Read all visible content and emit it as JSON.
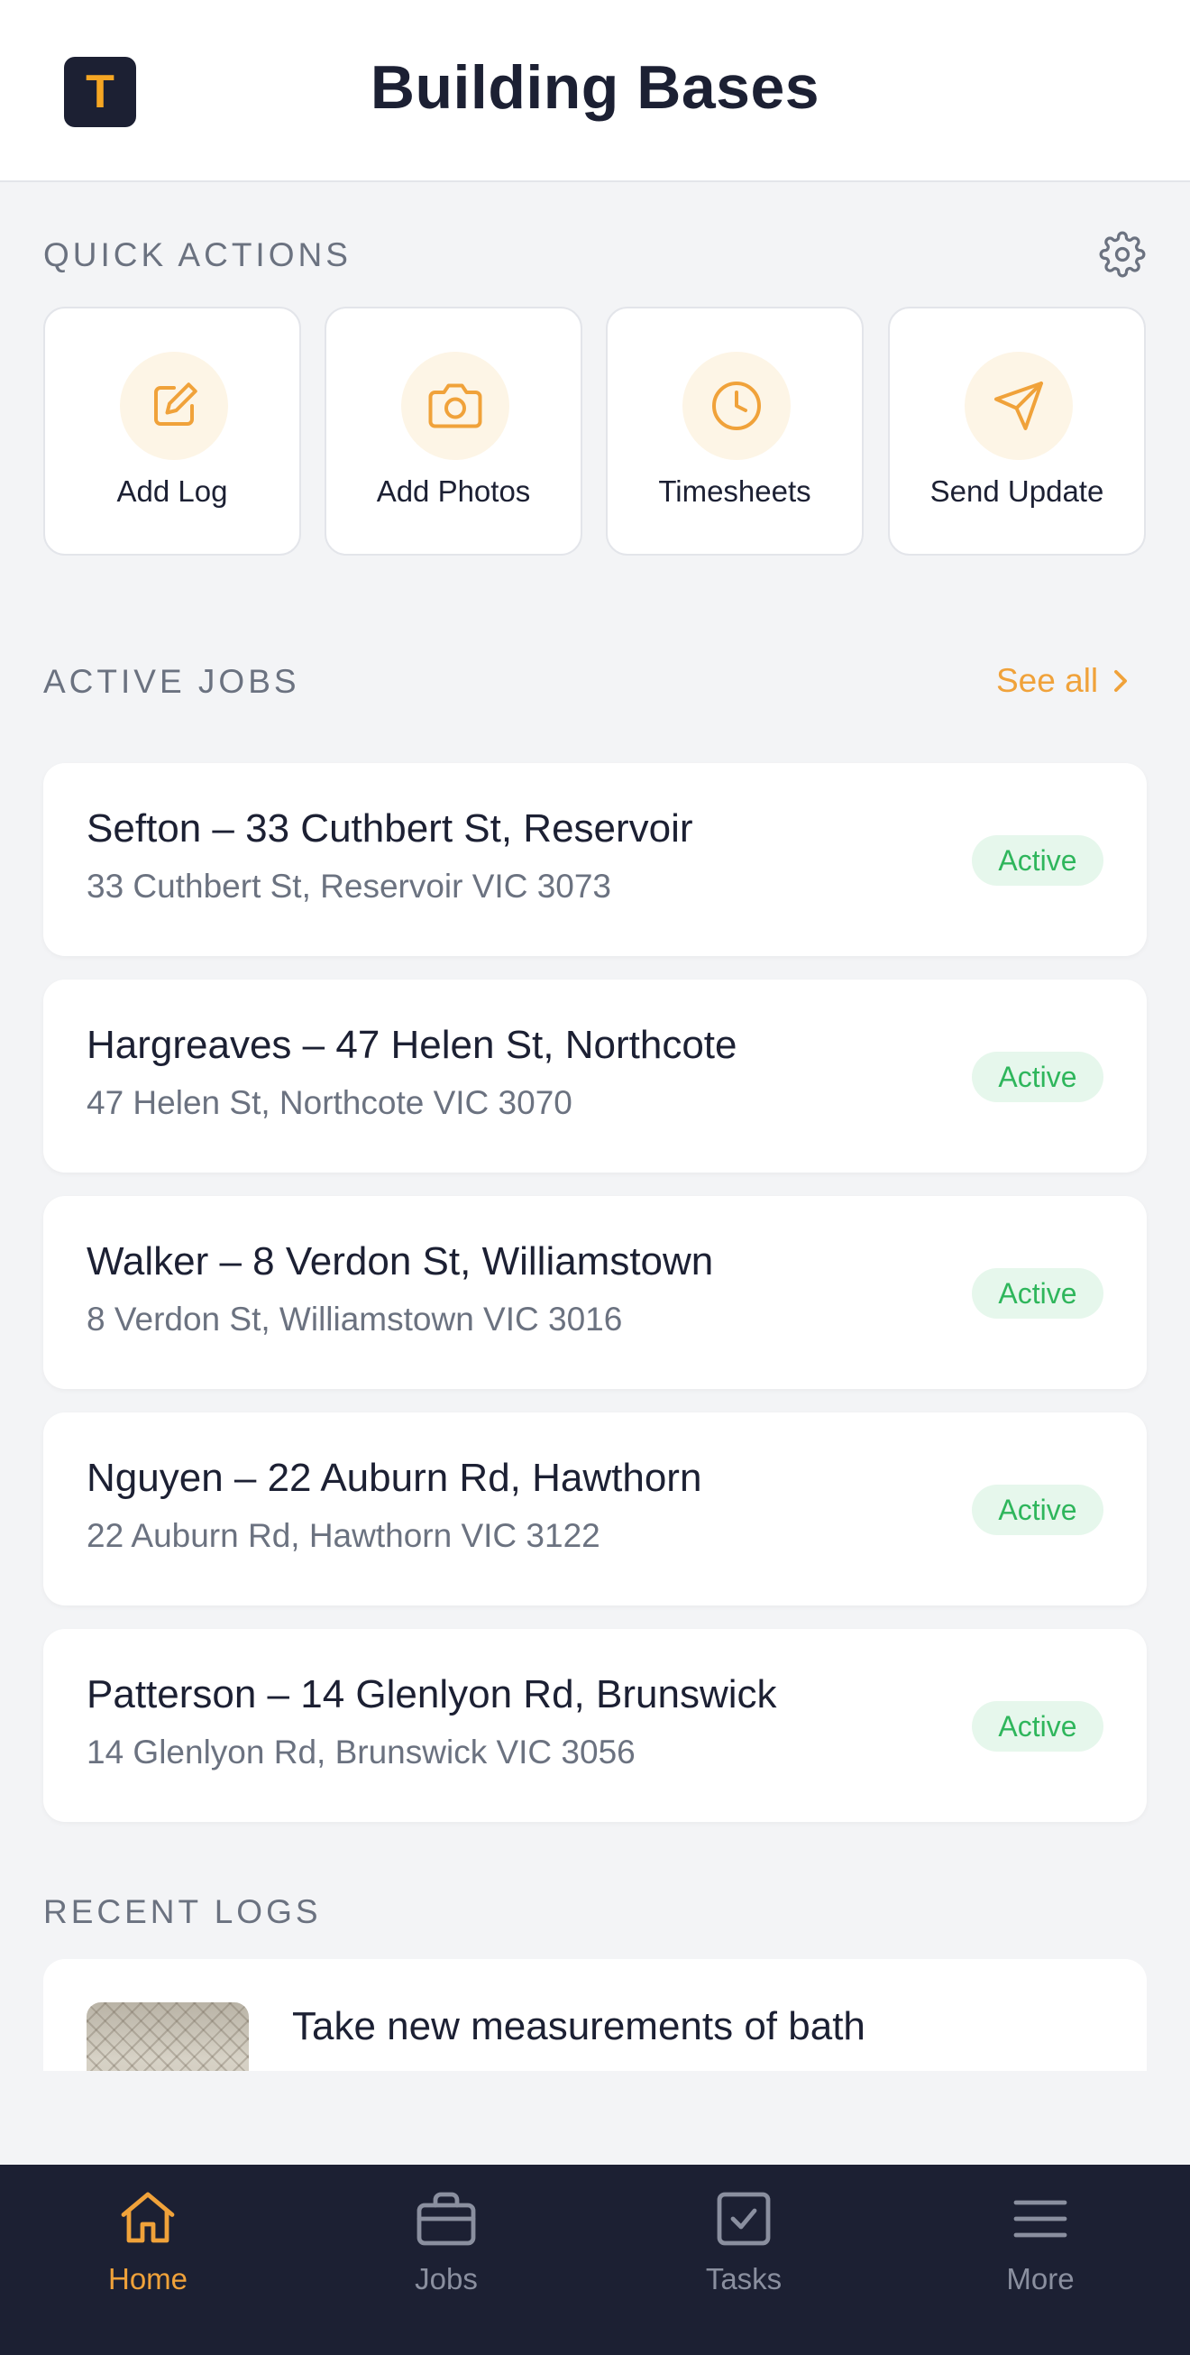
{
  "header": {
    "logo_letter": "T",
    "title": "Building Bases"
  },
  "quick_actions": {
    "label": "QUICK ACTIONS",
    "items": [
      {
        "label": "Add Log",
        "icon": "edit-icon"
      },
      {
        "label": "Add Photos",
        "icon": "camera-icon"
      },
      {
        "label": "Timesheets",
        "icon": "clock-icon"
      },
      {
        "label": "Send Update",
        "icon": "send-icon"
      }
    ]
  },
  "active_jobs": {
    "label": "ACTIVE JOBS",
    "see_all": "See all",
    "items": [
      {
        "title": "Sefton – 33 Cuthbert St, Reservoir",
        "address": "33 Cuthbert St, Reservoir VIC 3073",
        "status": "Active"
      },
      {
        "title": "Hargreaves – 47 Helen St, Northcote",
        "address": "47 Helen St, Northcote VIC 3070",
        "status": "Active"
      },
      {
        "title": "Walker – 8 Verdon St, Williamstown",
        "address": "8 Verdon St, Williamstown VIC 3016",
        "status": "Active"
      },
      {
        "title": "Nguyen – 22 Auburn Rd, Hawthorn",
        "address": "22 Auburn Rd, Hawthorn VIC 3122",
        "status": "Active"
      },
      {
        "title": "Patterson – 14 Glenlyon Rd, Brunswick",
        "address": "14 Glenlyon Rd, Brunswick VIC 3056",
        "status": "Active"
      }
    ]
  },
  "recent_logs": {
    "label": "RECENT LOGS",
    "items": [
      {
        "title": "Take new measurements of bath"
      }
    ]
  },
  "bottom_nav": {
    "items": [
      {
        "label": "Home",
        "icon": "home-icon",
        "active": true
      },
      {
        "label": "Jobs",
        "icon": "briefcase-icon",
        "active": false
      },
      {
        "label": "Tasks",
        "icon": "checkbox-icon",
        "active": false
      },
      {
        "label": "More",
        "icon": "menu-icon",
        "active": false
      }
    ]
  },
  "colors": {
    "accent": "#f0a23a",
    "navy": "#1c2033",
    "active_green": "#2fb65c",
    "active_badge_bg": "#e6f7ec",
    "nav_inactive": "#8a8f9f"
  }
}
